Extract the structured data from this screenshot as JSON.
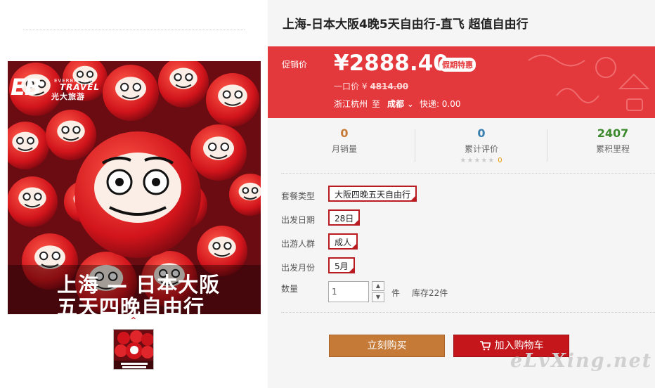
{
  "product": {
    "title": "上海-日本大阪4晚5天自由行-直飞 超值自由行",
    "image_caption_line1": "上海 — 日本大阪",
    "image_caption_line2": "五天四晚自由行",
    "logo": {
      "mark": "EB",
      "brand_en_small": "EVERBRIGHT",
      "brand_en": "TRAVEL",
      "brand_cn": "光大旅游"
    }
  },
  "price": {
    "promo_label": "促销价",
    "current": "¥2888.40",
    "badge": "假期特惠",
    "original_label": "一口价 ¥",
    "original_value": "4814.00",
    "route_from": "浙江杭州",
    "route_to_label": "至",
    "route_to": "成都",
    "shipping": "快递: 0.00"
  },
  "stats": [
    {
      "value": "0",
      "label": "月销量",
      "color": "#c57a37"
    },
    {
      "value": "0",
      "label": "累计评价",
      "color": "#3a7fb0"
    },
    {
      "value": "2407",
      "label": "累积里程",
      "color": "#3d8a2e"
    }
  ],
  "rating": {
    "stars": "★★★★★",
    "count": "0"
  },
  "options": [
    {
      "label": "套餐类型",
      "value": "大阪四晚五天自由行"
    },
    {
      "label": "出发日期",
      "value": "28日"
    },
    {
      "label": "出游人群",
      "value": "成人"
    },
    {
      "label": "出发月份",
      "value": "5月"
    }
  ],
  "quantity": {
    "label": "数量",
    "value": "1",
    "unit": "件",
    "stock": "库存22件",
    "up": "▲",
    "down": "▼"
  },
  "buttons": {
    "buy": "立刻购买",
    "cart": "加入购物车"
  },
  "watermark": "eLvXing.net",
  "colors": {
    "accent_red": "#e4393c",
    "buy_brown": "#c57a37",
    "cart_red": "#c4161b"
  }
}
